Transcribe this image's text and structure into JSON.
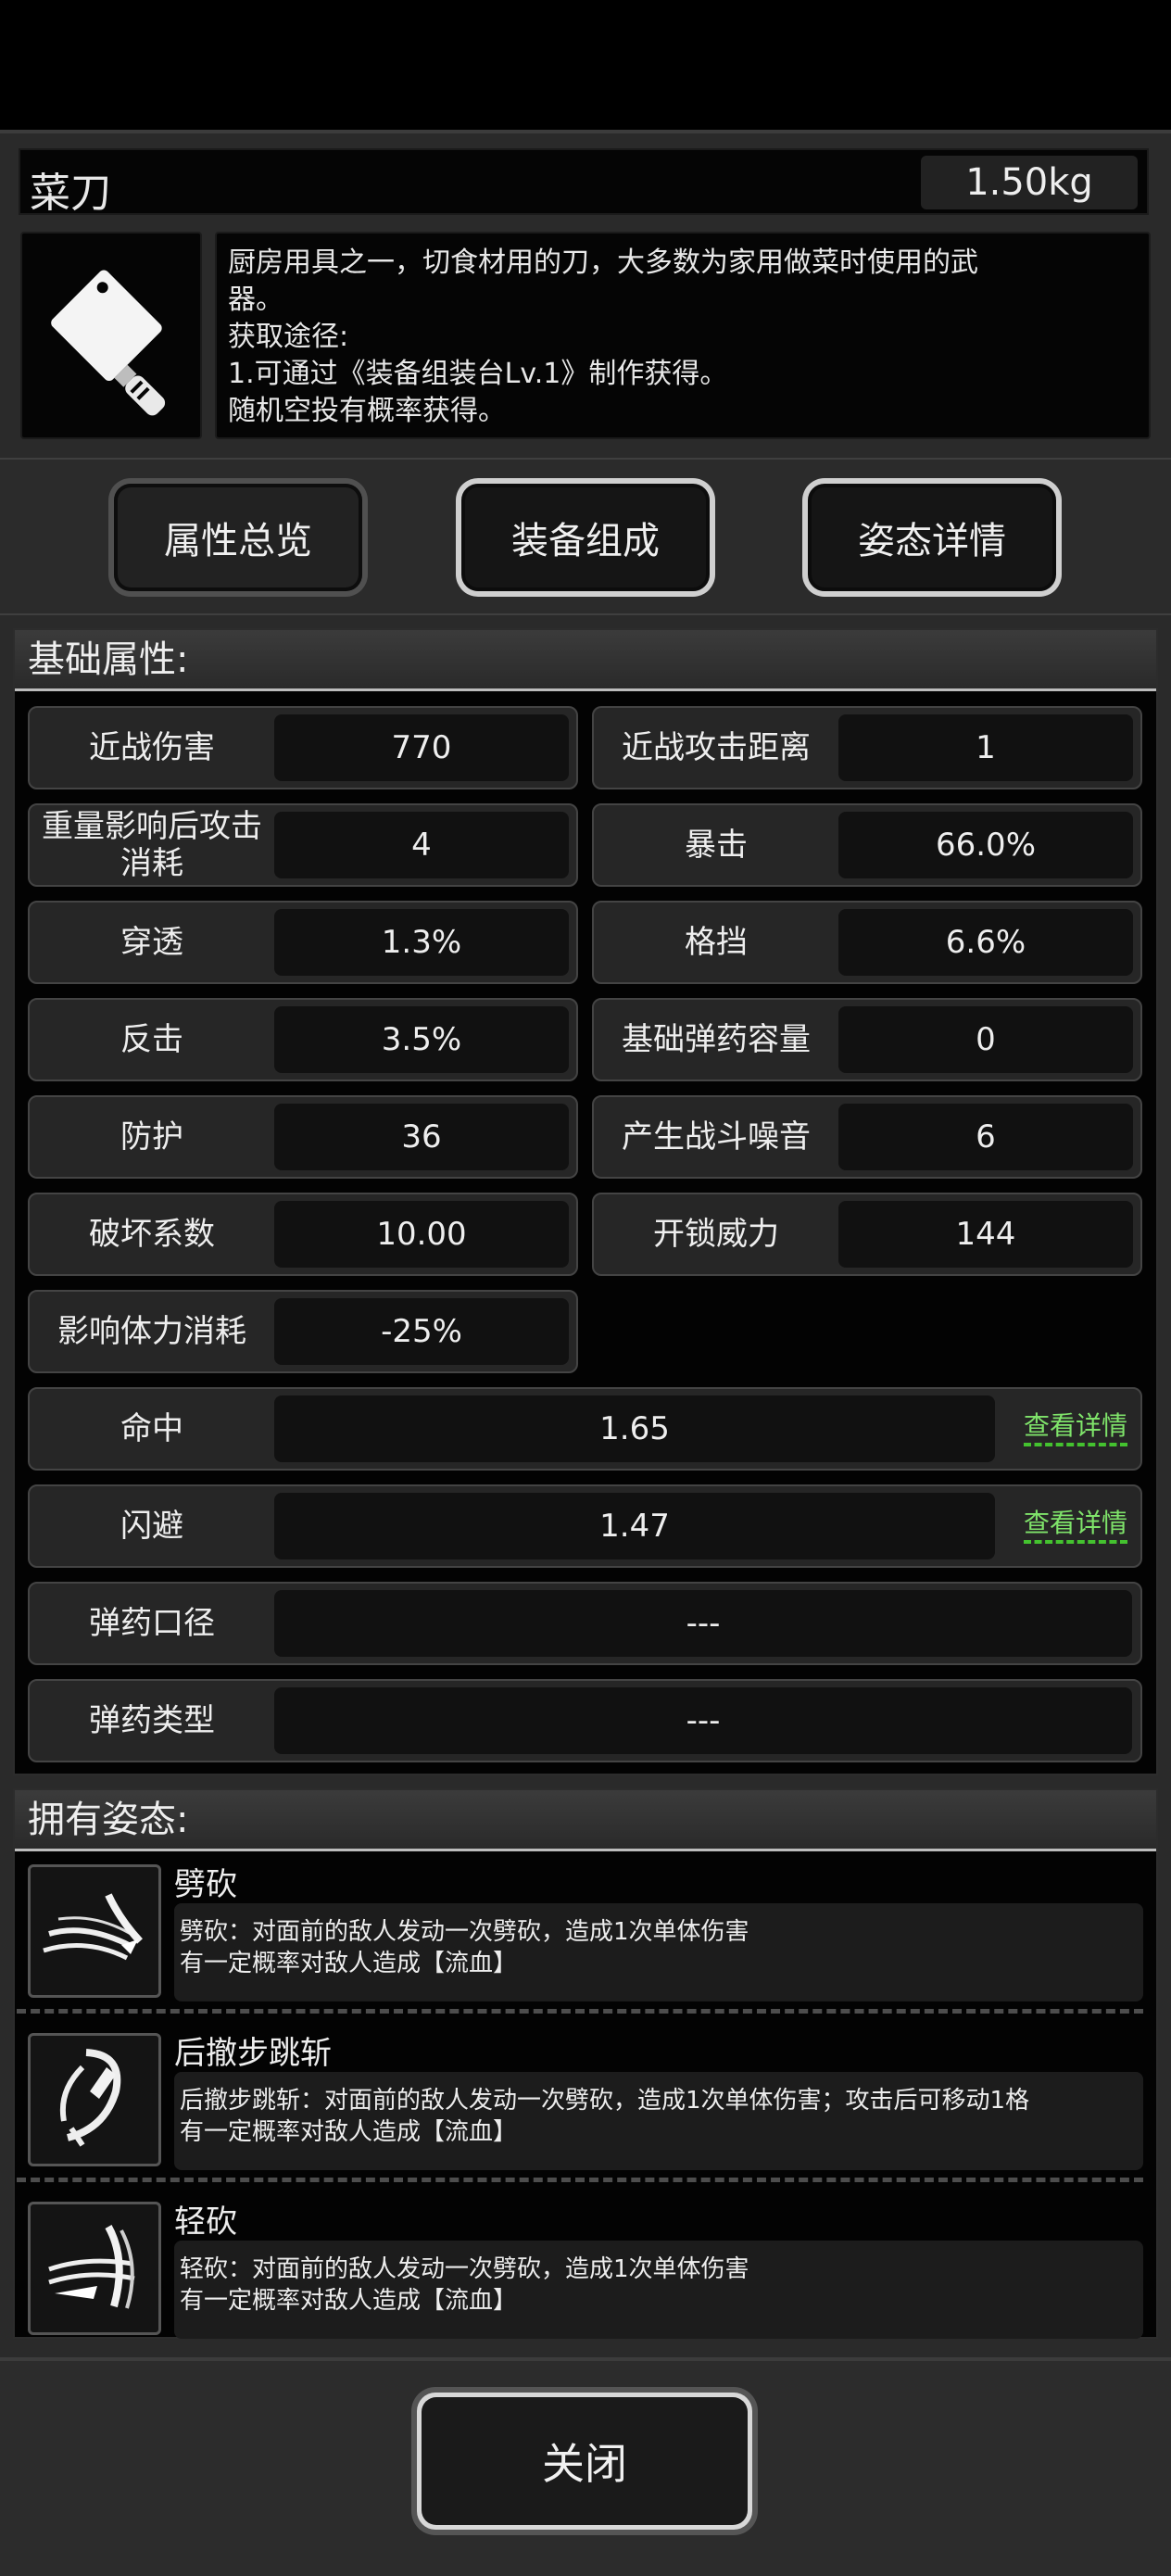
{
  "item": {
    "name": "菜刀",
    "weight": "1.50kg",
    "description": [
      "厨房用具之一，切食材用的刀，大多数为家用做菜时使用的武",
      "器。",
      "获取途径:",
      "1.可通过《装备组装台Lv.1》制作获得。",
      "随机空投有概率获得。"
    ]
  },
  "tabs": [
    "属性总览",
    "装备组成",
    "姿态详情"
  ],
  "base_section": {
    "title": "基础属性:"
  },
  "stats": [
    {
      "label": "近战伤害",
      "value": "770"
    },
    {
      "label": "近战攻击距离",
      "value": "1"
    },
    {
      "label": "重量影响后攻击消耗",
      "value": "4"
    },
    {
      "label": "暴击",
      "value": "66.0%"
    },
    {
      "label": "穿透",
      "value": "1.3%"
    },
    {
      "label": "格挡",
      "value": "6.6%"
    },
    {
      "label": "反击",
      "value": "3.5%"
    },
    {
      "label": "基础弹药容量",
      "value": "0"
    },
    {
      "label": "防护",
      "value": "36"
    },
    {
      "label": "产生战斗噪音",
      "value": "6"
    },
    {
      "label": "破坏系数",
      "value": "10.00"
    },
    {
      "label": "开锁威力",
      "value": "144"
    },
    {
      "label": "影响体力消耗",
      "value": "-25%"
    }
  ],
  "wide_stats": [
    {
      "label": "命中",
      "value": "1.65",
      "link": "查看详情"
    },
    {
      "label": "闪避",
      "value": "1.47",
      "link": "查看详情"
    },
    {
      "label": "弹药口径",
      "value": "---"
    },
    {
      "label": "弹药类型",
      "value": "---"
    }
  ],
  "posture_section": {
    "title": "拥有姿态:"
  },
  "postures": [
    {
      "name": "劈砍",
      "line1": "劈砍：对面前的敌人发动一次劈砍，造成1次单体伤害",
      "line2": "有一定概率对敌人造成【流血】"
    },
    {
      "name": "后撤步跳斩",
      "line1": "后撤步跳斩：对面前的敌人发动一次劈砍，造成1次单体伤害；攻击后可移动1格",
      "line2": "有一定概率对敌人造成【流血】"
    },
    {
      "name": "轻砍",
      "line1": "轻砍：对面前的敌人发动一次劈砍，造成1次单体伤害",
      "line2": "有一定概率对敌人造成【流血】"
    }
  ],
  "footer": {
    "close_label": "关闭"
  },
  "icons": [
    "cleaver-icon",
    "chop-slash-icon",
    "backstep-jump-slash-icon",
    "light-slash-icon"
  ]
}
